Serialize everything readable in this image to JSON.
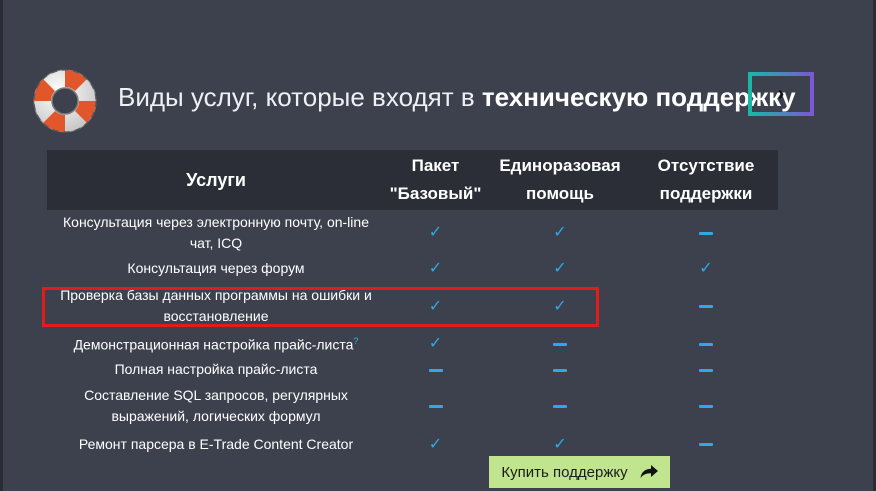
{
  "header": {
    "title_regular": "Виды услуг, которые входят в",
    "title_bold": "техническую поддержку",
    "next_icon": "chevron-right-icon"
  },
  "table": {
    "columns": [
      "Услуги",
      "Пакет \"Базовый\"",
      "Единоразовая помощь",
      "Отсутствие поддержки"
    ],
    "rows": [
      {
        "name": "Консультация через электронную почту, on-line чат, ICQ",
        "hint": "",
        "cells": [
          "check",
          "check",
          "dash"
        ]
      },
      {
        "name": "Консультация через форум",
        "hint": "",
        "cells": [
          "check",
          "check",
          "check"
        ]
      },
      {
        "name": "Проверка базы данных программы на ошибки и восстановление",
        "hint": "",
        "cells": [
          "check",
          "check",
          "dash"
        ]
      },
      {
        "name": "Демонстрационная настройка прайс-листа",
        "hint": "?",
        "cells": [
          "check",
          "dash",
          "dash"
        ]
      },
      {
        "name": "Полная настройка прайс-листа",
        "hint": "",
        "cells": [
          "dash",
          "dash",
          "dash"
        ]
      },
      {
        "name": "Составление SQL запросов, регулярных выражений, логических формул",
        "hint": "",
        "cells": [
          "dash",
          "dash",
          "dash"
        ]
      },
      {
        "name": "Ремонт парсера в E-Trade Content Creator",
        "hint": "",
        "cells": [
          "check",
          "check",
          "dash"
        ]
      }
    ]
  },
  "buy_button": {
    "label": "Купить поддержку",
    "icon": "share-arrow-icon"
  },
  "colors": {
    "background": "#3d414d",
    "header_row": "#2b2e36",
    "accent_blue": "#33a7e6",
    "highlight_red": "#e21b1b",
    "buy_green": "#c1e48f"
  }
}
